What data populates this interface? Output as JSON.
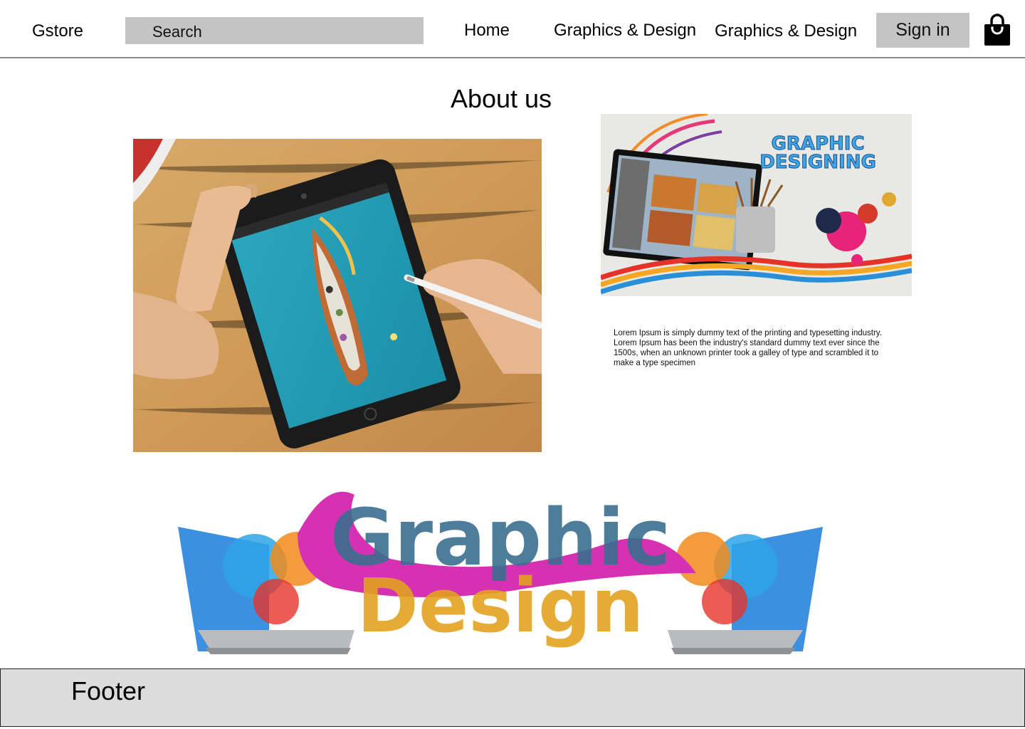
{
  "header": {
    "brand": "Gstore",
    "search_placeholder": "Search",
    "nav": [
      {
        "label": "Home"
      },
      {
        "label": "Graphics & Design"
      },
      {
        "label": "Graphics & Design"
      }
    ],
    "sign_in": "Sign in",
    "cart_icon": "shopping-bag-icon"
  },
  "about": {
    "title": "About us",
    "banner_text": [
      "GRAPHIC",
      "DESIGNING"
    ],
    "description": "Lorem Ipsum is simply dummy text of the printing and typesetting industry. Lorem Ipsum has been the industry's standard dummy text ever since the 1500s, when an unknown printer took a galley of type and scrambled it to make a type specimen"
  },
  "hero": {
    "art_text": [
      "Graphic",
      "Design"
    ]
  },
  "footer": {
    "label": "Footer"
  },
  "colors": {
    "search_bg": "#c4c4c4",
    "signin_bg": "#c4c4c4",
    "footer_bg": "#dcdcdc",
    "header_rule": "#8a8a8a"
  }
}
